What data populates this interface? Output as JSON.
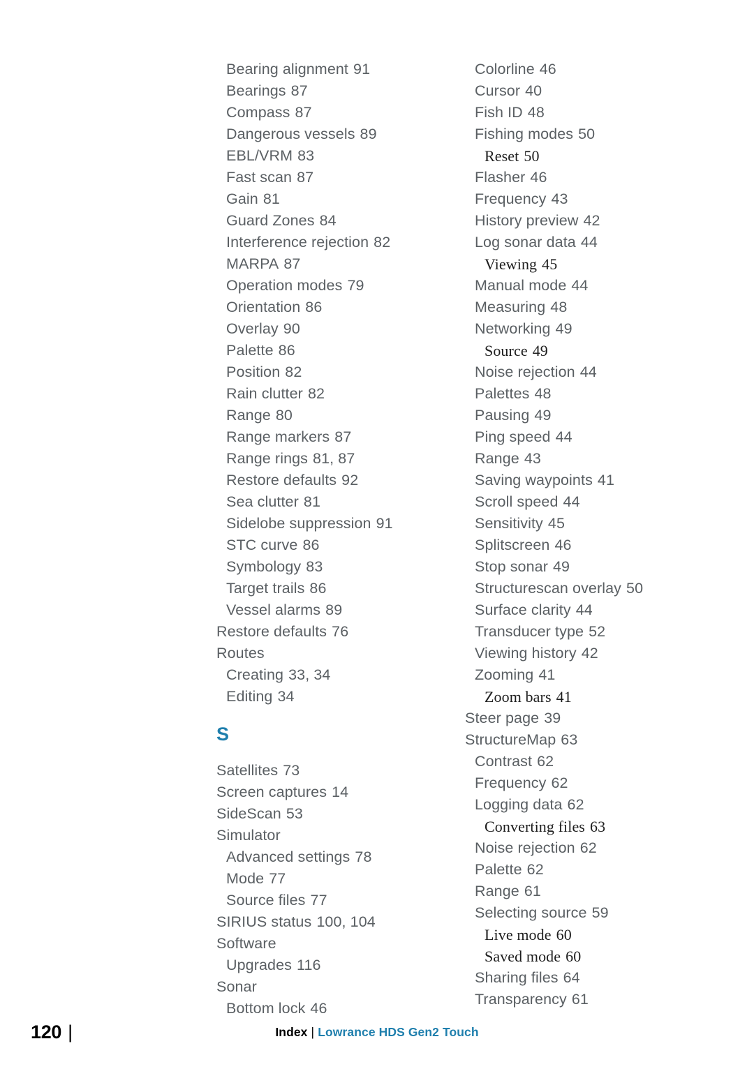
{
  "document": {
    "page_number": "120",
    "page_number_separator": "|",
    "footer": {
      "index_label": "Index",
      "separator": "|",
      "product_title": "Lowrance HDS Gen2 Touch"
    },
    "colors": {
      "body_text": "#5a5f63",
      "subentry_text": "#1d1d1d",
      "accent_blue": "#1f7fad",
      "page_number": "#000000",
      "background": "#ffffff"
    }
  },
  "columns": {
    "left": {
      "blocks": [
        {
          "type": "entries",
          "items": [
            {
              "label": "Bearing alignment",
              "pages": "91",
              "level": 1,
              "style": "sans"
            },
            {
              "label": "Bearings",
              "pages": "87",
              "level": 1,
              "style": "sans"
            },
            {
              "label": "Compass",
              "pages": "87",
              "level": 1,
              "style": "sans"
            },
            {
              "label": "Dangerous vessels",
              "pages": "89",
              "level": 1,
              "style": "sans"
            },
            {
              "label": "EBL/VRM",
              "pages": "83",
              "level": 1,
              "style": "sans"
            },
            {
              "label": "Fast scan",
              "pages": "87",
              "level": 1,
              "style": "sans"
            },
            {
              "label": "Gain",
              "pages": "81",
              "level": 1,
              "style": "sans"
            },
            {
              "label": "Guard Zones",
              "pages": "84",
              "level": 1,
              "style": "sans"
            },
            {
              "label": "Interference rejection",
              "pages": "82",
              "level": 1,
              "style": "sans"
            },
            {
              "label": "MARPA",
              "pages": "87",
              "level": 1,
              "style": "sans"
            },
            {
              "label": "Operation modes",
              "pages": "79",
              "level": 1,
              "style": "sans"
            },
            {
              "label": "Orientation",
              "pages": "86",
              "level": 1,
              "style": "sans"
            },
            {
              "label": "Overlay",
              "pages": "90",
              "level": 1,
              "style": "sans"
            },
            {
              "label": "Palette",
              "pages": "86",
              "level": 1,
              "style": "sans"
            },
            {
              "label": "Position",
              "pages": "82",
              "level": 1,
              "style": "sans"
            },
            {
              "label": "Rain clutter",
              "pages": "82",
              "level": 1,
              "style": "sans"
            },
            {
              "label": "Range",
              "pages": "80",
              "level": 1,
              "style": "sans"
            },
            {
              "label": "Range markers",
              "pages": "87",
              "level": 1,
              "style": "sans"
            },
            {
              "label": "Range rings",
              "pages": "81, 87",
              "level": 1,
              "style": "sans"
            },
            {
              "label": "Restore defaults",
              "pages": "92",
              "level": 1,
              "style": "sans"
            },
            {
              "label": "Sea clutter",
              "pages": "81",
              "level": 1,
              "style": "sans"
            },
            {
              "label": "Sidelobe suppression",
              "pages": "91",
              "level": 1,
              "style": "sans"
            },
            {
              "label": "STC curve",
              "pages": "86",
              "level": 1,
              "style": "sans"
            },
            {
              "label": "Symbology",
              "pages": "83",
              "level": 1,
              "style": "sans"
            },
            {
              "label": "Target trails",
              "pages": "86",
              "level": 1,
              "style": "sans"
            },
            {
              "label": "Vessel alarms",
              "pages": "89",
              "level": 1,
              "style": "sans"
            },
            {
              "label": "Restore defaults",
              "pages": "76",
              "level": 0,
              "style": "sans"
            },
            {
              "label": "Routes",
              "pages": "",
              "level": 0,
              "style": "sans"
            },
            {
              "label": "Creating",
              "pages": "33, 34",
              "level": 1,
              "style": "sans"
            },
            {
              "label": "Editing",
              "pages": "34",
              "level": 1,
              "style": "sans"
            }
          ]
        },
        {
          "type": "section-letter",
          "letter": "S"
        },
        {
          "type": "entries",
          "items": [
            {
              "label": "Satellites",
              "pages": "73",
              "level": 0,
              "style": "sans"
            },
            {
              "label": "Screen captures",
              "pages": "14",
              "level": 0,
              "style": "sans"
            },
            {
              "label": "SideScan",
              "pages": "53",
              "level": 0,
              "style": "sans"
            },
            {
              "label": "Simulator",
              "pages": "",
              "level": 0,
              "style": "sans"
            },
            {
              "label": "Advanced settings",
              "pages": "78",
              "level": 1,
              "style": "sans"
            },
            {
              "label": "Mode",
              "pages": "77",
              "level": 1,
              "style": "sans"
            },
            {
              "label": "Source files",
              "pages": "77",
              "level": 1,
              "style": "sans"
            },
            {
              "label": "SIRIUS status",
              "pages": "100, 104",
              "level": 0,
              "style": "sans"
            },
            {
              "label": "Software",
              "pages": "",
              "level": 0,
              "style": "sans"
            },
            {
              "label": "Upgrades",
              "pages": "116",
              "level": 1,
              "style": "sans"
            },
            {
              "label": "Sonar",
              "pages": "",
              "level": 0,
              "style": "sans"
            },
            {
              "label": "Bottom lock",
              "pages": "46",
              "level": 1,
              "style": "sans"
            }
          ]
        }
      ]
    },
    "right": {
      "blocks": [
        {
          "type": "entries",
          "items": [
            {
              "label": "Colorline",
              "pages": "46",
              "level": 1,
              "style": "sans"
            },
            {
              "label": "Cursor",
              "pages": "40",
              "level": 1,
              "style": "sans"
            },
            {
              "label": "Fish ID",
              "pages": "48",
              "level": 1,
              "style": "sans"
            },
            {
              "label": "Fishing modes",
              "pages": "50",
              "level": 1,
              "style": "sans"
            },
            {
              "label": "Reset",
              "pages": "50",
              "level": 2,
              "style": "serif"
            },
            {
              "label": "Flasher",
              "pages": "46",
              "level": 1,
              "style": "sans"
            },
            {
              "label": "Frequency",
              "pages": "43",
              "level": 1,
              "style": "sans"
            },
            {
              "label": "History preview",
              "pages": "42",
              "level": 1,
              "style": "sans"
            },
            {
              "label": "Log sonar data",
              "pages": "44",
              "level": 1,
              "style": "sans"
            },
            {
              "label": "Viewing",
              "pages": "45",
              "level": 2,
              "style": "serif"
            },
            {
              "label": "Manual mode",
              "pages": "44",
              "level": 1,
              "style": "sans"
            },
            {
              "label": "Measuring",
              "pages": "48",
              "level": 1,
              "style": "sans"
            },
            {
              "label": "Networking",
              "pages": "49",
              "level": 1,
              "style": "sans"
            },
            {
              "label": "Source",
              "pages": "49",
              "level": 2,
              "style": "serif"
            },
            {
              "label": "Noise rejection",
              "pages": "44",
              "level": 1,
              "style": "sans"
            },
            {
              "label": "Palettes",
              "pages": "48",
              "level": 1,
              "style": "sans"
            },
            {
              "label": "Pausing",
              "pages": "49",
              "level": 1,
              "style": "sans"
            },
            {
              "label": "Ping speed",
              "pages": "44",
              "level": 1,
              "style": "sans"
            },
            {
              "label": "Range",
              "pages": "43",
              "level": 1,
              "style": "sans"
            },
            {
              "label": "Saving waypoints",
              "pages": "41",
              "level": 1,
              "style": "sans"
            },
            {
              "label": "Scroll speed",
              "pages": "44",
              "level": 1,
              "style": "sans"
            },
            {
              "label": "Sensitivity",
              "pages": "45",
              "level": 1,
              "style": "sans"
            },
            {
              "label": "Splitscreen",
              "pages": "46",
              "level": 1,
              "style": "sans"
            },
            {
              "label": "Stop sonar",
              "pages": "49",
              "level": 1,
              "style": "sans"
            },
            {
              "label": "Structurescan overlay",
              "pages": "50",
              "level": 1,
              "style": "sans"
            },
            {
              "label": "Surface clarity",
              "pages": "44",
              "level": 1,
              "style": "sans"
            },
            {
              "label": "Transducer type",
              "pages": "52",
              "level": 1,
              "style": "sans"
            },
            {
              "label": "Viewing history",
              "pages": "42",
              "level": 1,
              "style": "sans"
            },
            {
              "label": "Zooming",
              "pages": "41",
              "level": 1,
              "style": "sans"
            },
            {
              "label": "Zoom bars",
              "pages": "41",
              "level": 2,
              "style": "serif"
            },
            {
              "label": "Steer page",
              "pages": "39",
              "level": 0,
              "style": "sans"
            },
            {
              "label": "StructureMap",
              "pages": "63",
              "level": 0,
              "style": "sans"
            },
            {
              "label": "Contrast",
              "pages": "62",
              "level": 1,
              "style": "sans"
            },
            {
              "label": "Frequency",
              "pages": "62",
              "level": 1,
              "style": "sans"
            },
            {
              "label": "Logging data",
              "pages": "62",
              "level": 1,
              "style": "sans"
            },
            {
              "label": "Converting files",
              "pages": "63",
              "level": 2,
              "style": "serif"
            },
            {
              "label": "Noise rejection",
              "pages": "62",
              "level": 1,
              "style": "sans"
            },
            {
              "label": "Palette",
              "pages": "62",
              "level": 1,
              "style": "sans"
            },
            {
              "label": "Range",
              "pages": "61",
              "level": 1,
              "style": "sans"
            },
            {
              "label": "Selecting source",
              "pages": "59",
              "level": 1,
              "style": "sans"
            },
            {
              "label": "Live mode",
              "pages": "60",
              "level": 2,
              "style": "serif"
            },
            {
              "label": "Saved mode",
              "pages": "60",
              "level": 2,
              "style": "serif"
            },
            {
              "label": "Sharing files",
              "pages": "64",
              "level": 1,
              "style": "sans"
            },
            {
              "label": "Transparency",
              "pages": "61",
              "level": 1,
              "style": "sans"
            }
          ]
        }
      ]
    }
  }
}
